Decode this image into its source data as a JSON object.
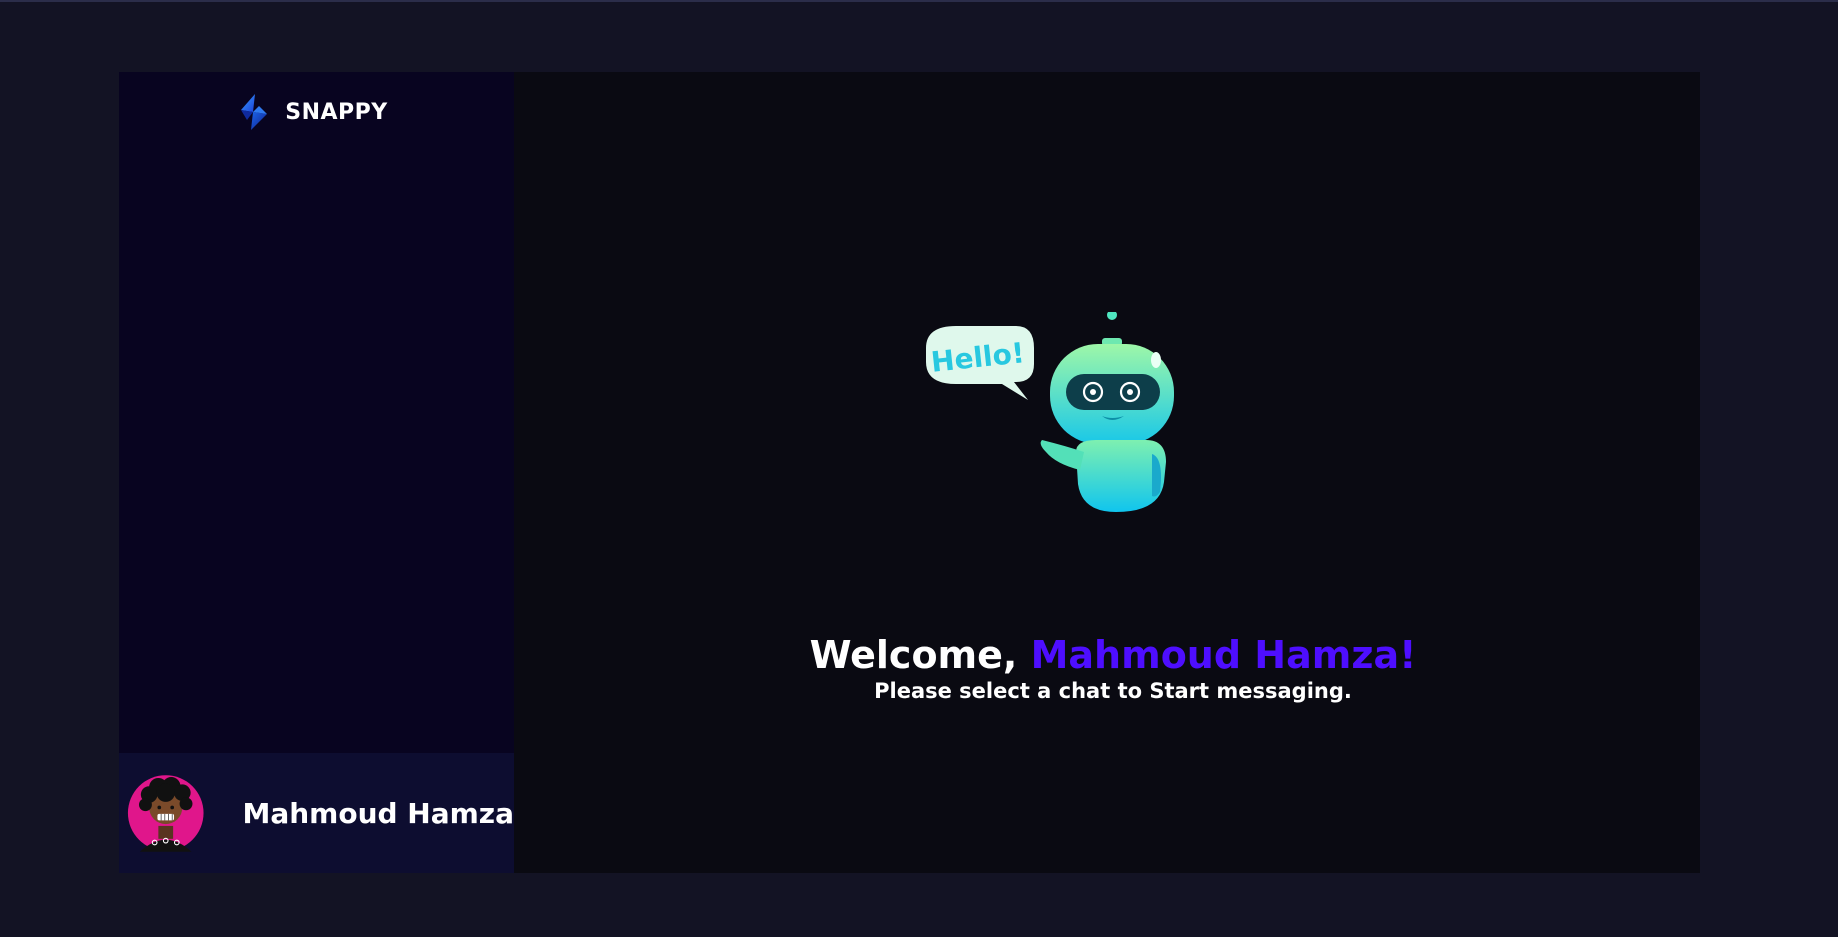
{
  "brand": {
    "name": "SNAPPY",
    "logo_icon": "snappy-logo-icon"
  },
  "current_user": {
    "name": "Mahmoud Hamza",
    "avatar_icon": "user-avatar-icon"
  },
  "welcome": {
    "greeting": "Welcome, ",
    "name": "Mahmoud Hamza!",
    "subtitle": "Please select a chat to Start messaging.",
    "illustration_icon": "robot-hello-icon",
    "speech_bubble_text": "Hello!"
  },
  "colors": {
    "background": "#131324",
    "sidebar": "#080420",
    "user_panel": "#0d0d30",
    "main": "#0a0a12",
    "accent": "#4e0eff"
  }
}
